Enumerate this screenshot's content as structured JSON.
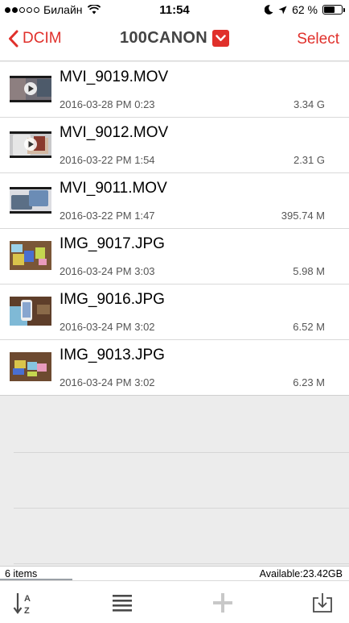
{
  "status_bar": {
    "carrier": "Билайн",
    "time": "11:54",
    "battery_percent": "62 %",
    "battery_level": 0.62,
    "signal_bars": 2
  },
  "nav": {
    "back_label": "DCIM",
    "title": "100CANON",
    "select_label": "Select",
    "accent_color": "#e0302b"
  },
  "files": [
    {
      "name": "MVI_9019.MOV",
      "date": "2016-03-28 PM 0:23",
      "size": "3.34 G",
      "type": "video"
    },
    {
      "name": "MVI_9012.MOV",
      "date": "2016-03-22 PM 1:54",
      "size": "2.31 G",
      "type": "video"
    },
    {
      "name": "MVI_9011.MOV",
      "date": "2016-03-22 PM 1:47",
      "size": "395.74 M",
      "type": "video"
    },
    {
      "name": "IMG_9017.JPG",
      "date": "2016-03-24 PM 3:03",
      "size": "5.98 M",
      "type": "photo"
    },
    {
      "name": "IMG_9016.JPG",
      "date": "2016-03-24 PM 3:02",
      "size": "6.52 M",
      "type": "photo"
    },
    {
      "name": "IMG_9013.JPG",
      "date": "2016-03-24 PM 3:02",
      "size": "6.23 M",
      "type": "photo"
    }
  ],
  "footer": {
    "items_count": "6 items",
    "available": "Available:23.42GB"
  },
  "toolbar": {
    "icons": [
      "sort-az-icon",
      "list-view-icon",
      "add-icon",
      "download-icon"
    ]
  }
}
